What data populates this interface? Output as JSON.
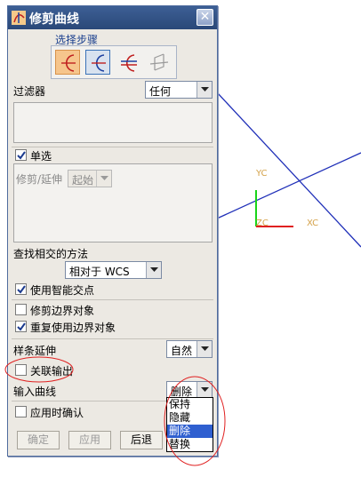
{
  "dialog": {
    "title": "修剪曲线",
    "close_symbol": "✕"
  },
  "selection_steps": {
    "label": "选择步骤"
  },
  "filter": {
    "label": "过滤器",
    "value": "任何"
  },
  "single_select": {
    "label": "单选",
    "checked": true
  },
  "trim_extend": {
    "label": "修剪/延伸",
    "value": "起始"
  },
  "intersection": {
    "label": "查找相交的方法",
    "value": "相对于 WCS"
  },
  "options": [
    {
      "label": "使用智能交点",
      "checked": true
    },
    {
      "label": "修剪边界对象",
      "checked": false
    },
    {
      "label": "重复使用边界对象",
      "checked": true
    }
  ],
  "spline_extend": {
    "label": "样条延伸",
    "value": "自然"
  },
  "associative_output": {
    "label": "关联输出",
    "checked": false
  },
  "input_curve": {
    "label": "输入曲线",
    "value": "删除",
    "options": [
      "保持",
      "隐藏",
      "删除",
      "替换"
    ],
    "selected_index": 2
  },
  "confirm_on_apply": {
    "label": "应用时确认",
    "checked": false
  },
  "buttons": {
    "ok": "确定",
    "apply": "应用",
    "back": "后退"
  },
  "viewport": {
    "yc_label": "YC",
    "xc_label": "XC",
    "zc_label": "ZC",
    "colors": {
      "line": "#1f2fb8",
      "x_axis": "#e02020",
      "y_axis": "#19d419",
      "annotation": "#e02020"
    }
  }
}
